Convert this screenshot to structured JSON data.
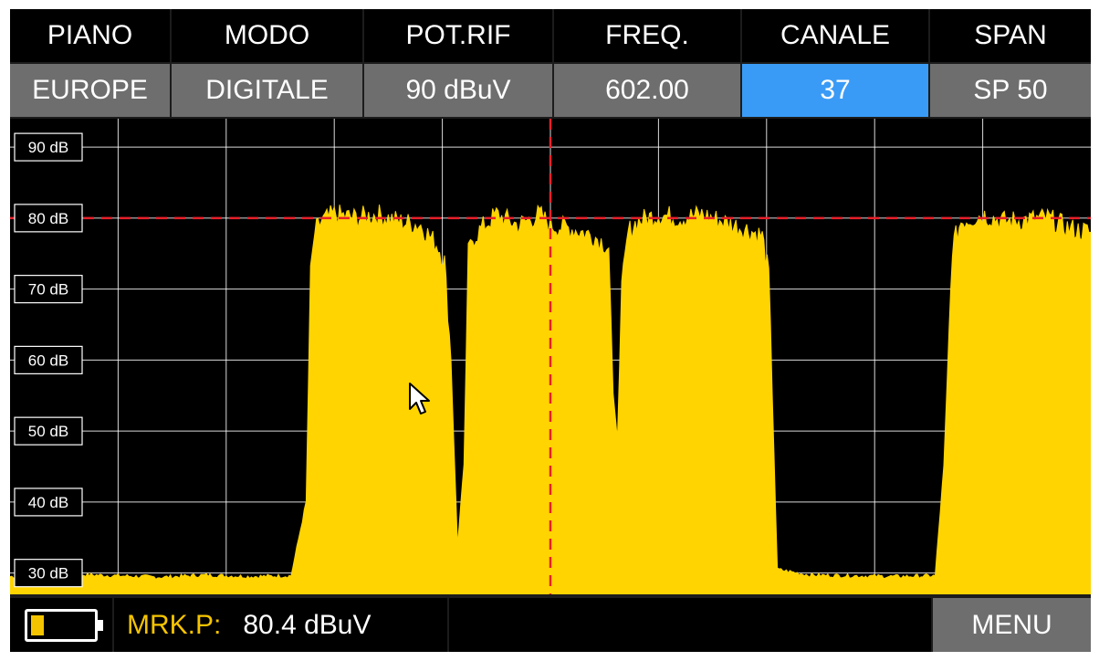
{
  "header": {
    "labels": [
      "PIANO",
      "MODO",
      "POT.RIF",
      "FREQ.",
      "CANALE",
      "SPAN"
    ],
    "values": [
      "EUROPE",
      "DIGITALE",
      "90 dBuV",
      "602.00",
      "37",
      "SP 50"
    ],
    "selected_index": 4
  },
  "plot": {
    "y_ticks": [
      "90 dB",
      "80 dB",
      "70 dB",
      "60 dB",
      "50 dB",
      "40 dB",
      "30 dB"
    ],
    "reference_level_db": 80,
    "marker_freq_mhz": 602.0,
    "trace_color": "#ffd400",
    "marker_color": "#e8202a",
    "grid_color": "#ffffff"
  },
  "chart_data": {
    "type": "area",
    "title": "",
    "xlabel": "",
    "ylabel": "",
    "xlim": [
      577,
      627
    ],
    "ylim": [
      27,
      94
    ],
    "y_ticks": [
      90,
      80,
      70,
      60,
      50,
      40,
      30
    ],
    "series": [
      {
        "x": [
          577,
          578,
          580,
          582,
          584,
          586,
          588,
          590,
          590.7,
          590.9,
          591.1,
          591.4,
          592,
          593,
          594,
          595,
          596,
          596.8,
          597.1,
          597.4,
          597.7,
          598,
          598.2,
          598.4,
          598.8,
          599.5,
          600.5,
          601.5,
          602,
          603,
          604,
          604.7,
          604.9,
          605.1,
          605.3,
          605.6,
          606,
          607,
          608,
          609,
          610,
          611,
          611.8,
          612.1,
          612.5,
          614,
          616,
          618,
          619.8,
          620.2,
          620.6,
          621,
          622,
          623,
          625,
          626,
          627
        ],
        "y": [
          29.5,
          29.6,
          29.8,
          29.6,
          29.4,
          29.7,
          29.5,
          29.6,
          40,
          72,
          78,
          79.5,
          80.5,
          80,
          80.5,
          79.5,
          79,
          76,
          74,
          60,
          34,
          45,
          75,
          77,
          78.5,
          80.5,
          79,
          80.5,
          79,
          78.5,
          77.5,
          76,
          55,
          49,
          70,
          78,
          79.5,
          80.5,
          80,
          80.5,
          79.5,
          78.5,
          77.5,
          72,
          30.5,
          29.7,
          29.6,
          29.5,
          29.6,
          45,
          76,
          79.5,
          80.5,
          79.5,
          80,
          78.5,
          78
        ]
      }
    ]
  },
  "status": {
    "battery_level": 0.27,
    "marker_label": "MRK.P:",
    "marker_value": "80.4 dBuV",
    "menu_label": "MENU"
  }
}
